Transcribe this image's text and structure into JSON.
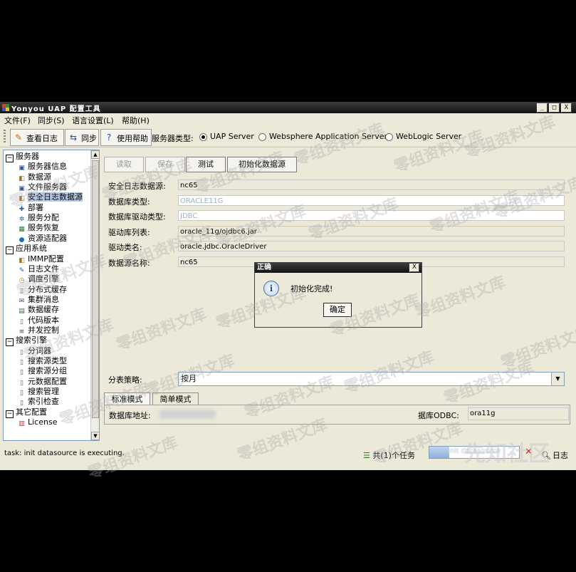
{
  "window": {
    "title": "Yonyou UAP 配置工具",
    "controls": {
      "minimize": "_",
      "maximize": "□",
      "close": "X"
    }
  },
  "menu": [
    "文件(F)",
    "同步(S)",
    "语言设置(L)",
    "帮助(H)"
  ],
  "toolbar": {
    "view_log": "查看日志",
    "sync": "同步",
    "help": "使用帮助",
    "server_type_label": "服务器类型:",
    "server_types": [
      {
        "label": "UAP Server",
        "selected": true
      },
      {
        "label": "Websphere Application Server",
        "selected": false
      },
      {
        "label": "WebLogic Server",
        "selected": false
      }
    ]
  },
  "tree": [
    {
      "label": "服务器",
      "level": 0,
      "group": true
    },
    {
      "label": "服务器信息",
      "level": 1,
      "icon": "monitor"
    },
    {
      "label": "数据源",
      "level": 1,
      "icon": "db"
    },
    {
      "label": "文件服务器",
      "level": 1,
      "icon": "monitor"
    },
    {
      "label": "安全日志数据源",
      "level": 1,
      "icon": "db",
      "selected": true
    },
    {
      "label": "部署",
      "level": 1,
      "icon": "deploy"
    },
    {
      "label": "服务分配",
      "level": 1,
      "icon": "network"
    },
    {
      "label": "服务恢复",
      "level": 1,
      "icon": "grid"
    },
    {
      "label": "资源适配器",
      "level": 1,
      "icon": "dot"
    },
    {
      "label": "应用系统",
      "level": 0,
      "group": true
    },
    {
      "label": "IMMP配置",
      "level": 1,
      "icon": "db"
    },
    {
      "label": "日志文件",
      "level": 1,
      "icon": "log"
    },
    {
      "label": "调度引擎",
      "level": 1,
      "icon": "clock"
    },
    {
      "label": "分布式缓存",
      "level": 1,
      "icon": "doc"
    },
    {
      "label": "集群消息",
      "level": 1,
      "icon": "mail"
    },
    {
      "label": "数据缓存",
      "level": 1,
      "icon": "table"
    },
    {
      "label": "代码版本",
      "level": 1,
      "icon": "doc"
    },
    {
      "label": "并发控制",
      "level": 1,
      "icon": "lines"
    },
    {
      "label": "搜索引擎",
      "level": 0,
      "group": true
    },
    {
      "label": "分词器",
      "level": 1,
      "icon": "doc"
    },
    {
      "label": "搜索源类型",
      "level": 1,
      "icon": "doc"
    },
    {
      "label": "搜索源分组",
      "level": 1,
      "icon": "doc"
    },
    {
      "label": "元数据配置",
      "level": 1,
      "icon": "doc"
    },
    {
      "label": "搜索管理",
      "level": 1,
      "icon": "doc"
    },
    {
      "label": "索引检查",
      "level": 1,
      "icon": "doc"
    },
    {
      "label": "其它配置",
      "level": 0,
      "group": true
    },
    {
      "label": "License",
      "level": 1,
      "icon": "license"
    }
  ],
  "actions": {
    "read": "读取",
    "save": "保存",
    "test": "测试",
    "init": "初始化数据源"
  },
  "form": {
    "rows": [
      {
        "label": "安全日志数据源:",
        "value": "nc65",
        "style": "ro"
      },
      {
        "label": "数据库类型:",
        "value": "ORACLE11G",
        "style": "ed"
      },
      {
        "label": "数据库驱动类型:",
        "value": "JDBC",
        "style": "ed"
      },
      {
        "label": "驱动库列表:",
        "value": "oracle_11g/ojdbc6.jar",
        "style": "ro"
      },
      {
        "label": "驱动类名:",
        "value": "oracle.jdbc.OracleDriver",
        "style": "ro"
      },
      {
        "label": "数据源名称:",
        "value": "nc65",
        "style": "ro"
      }
    ],
    "partition_label": "分表策略:",
    "partition_value": "按月"
  },
  "tabs": [
    "标准模式",
    "简单模式"
  ],
  "conn": {
    "db_address_label": "数据库地址:",
    "odbc_label": "据库ODBC:",
    "odbc_value": "ora11g"
  },
  "status": {
    "text": "task: init datasource is executing.",
    "tasks": "共(1)个任务",
    "progress_label": "init datasource",
    "progress": 0.22,
    "log": "日志"
  },
  "dialog": {
    "title": "正确",
    "close": "X",
    "icon": "i",
    "message": "初始化完成!",
    "ok": "确定"
  },
  "watermark": {
    "text": "零组资料文库",
    "brand": "先知社区"
  }
}
